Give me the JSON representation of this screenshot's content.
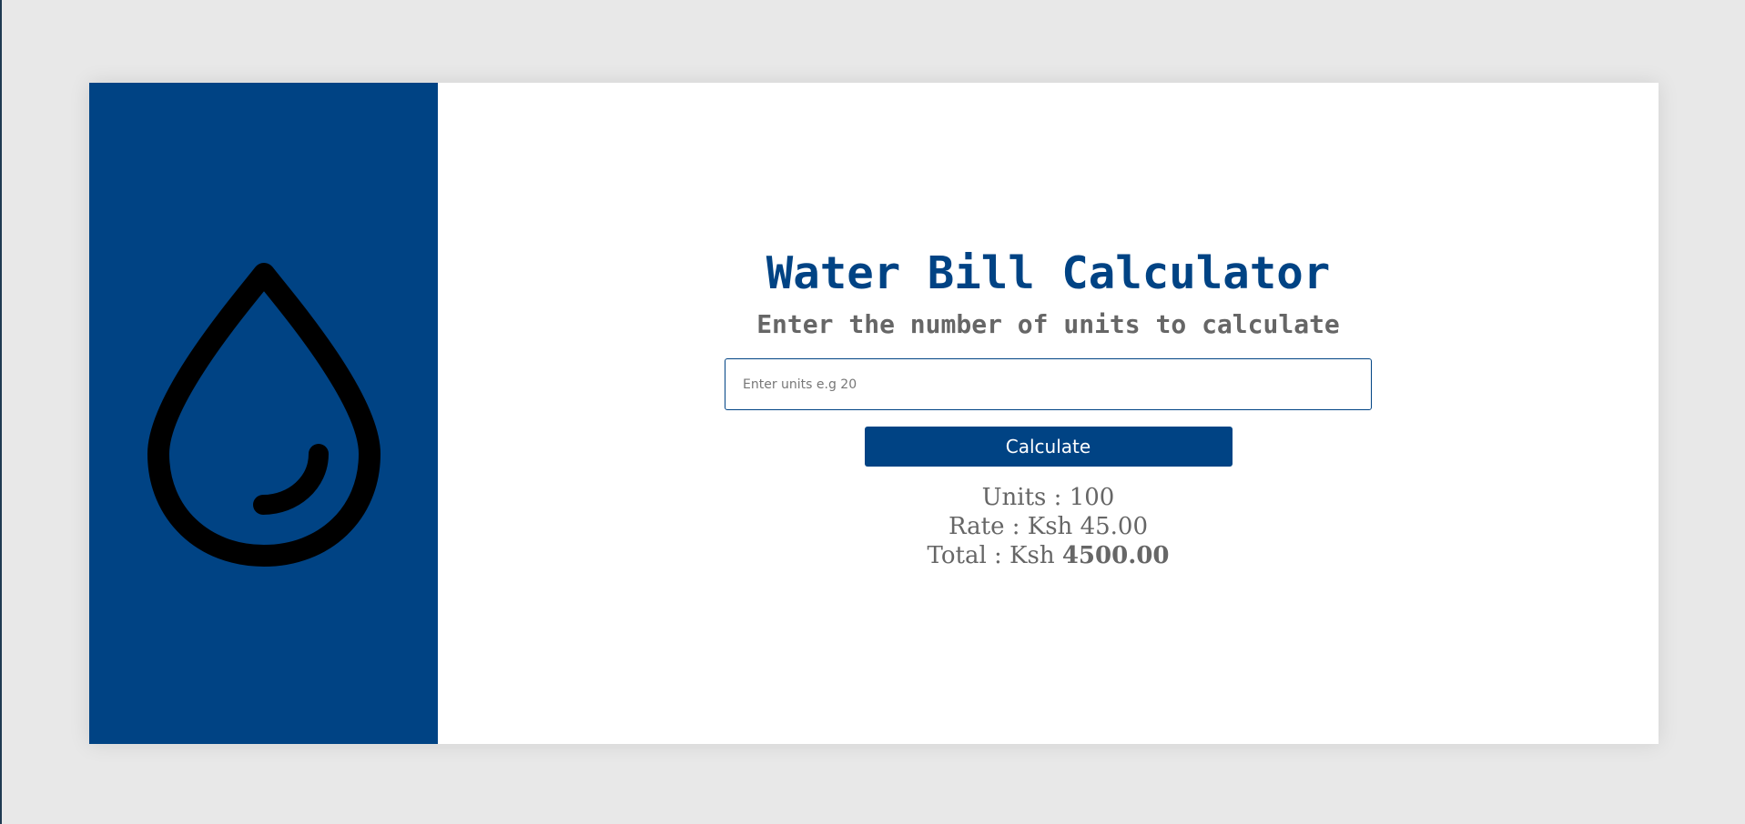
{
  "header": {
    "title": "Water Bill Calculator",
    "subtitle": "Enter the number of units to calculate"
  },
  "form": {
    "units_placeholder": "Enter units e.g 20",
    "units_value": "",
    "calculate_label": "Calculate"
  },
  "results": {
    "units_label": "Units : ",
    "units_value": "100",
    "rate_label": "Rate : Ksh ",
    "rate_value": "45.00",
    "total_label": "Total : Ksh ",
    "total_value": "4500.00"
  },
  "icons": {
    "sidebar_icon": "water-drop-icon"
  },
  "colors": {
    "primary": "#004384",
    "text_muted": "#666666",
    "page_background": "#e8e8e8",
    "card_background": "#ffffff",
    "icon_stroke": "#000000"
  }
}
